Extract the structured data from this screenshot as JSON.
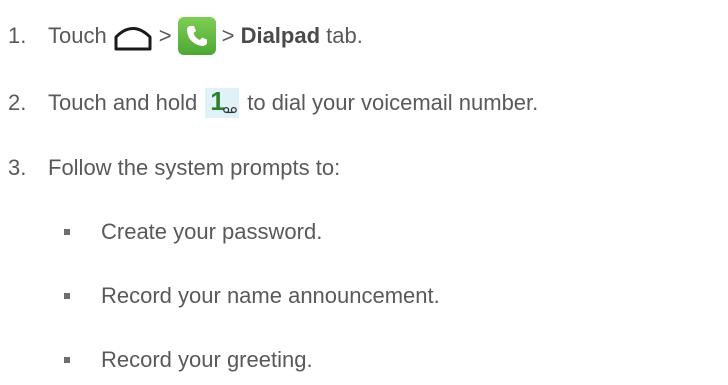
{
  "steps": [
    {
      "number": "1.",
      "touch": "Touch",
      "gt1": ">",
      "gt2": ">",
      "dialpad": "Dialpad",
      "tab": "tab.",
      "home_icon": "home-icon",
      "phone_icon": "phone-app-icon"
    },
    {
      "number": "2.",
      "before": "Touch and hold",
      "key_digit": "1",
      "after": "to dial your voicemail number.",
      "voicemail_icon": "voicemail-icon"
    },
    {
      "number": "3.",
      "text": "Follow the system prompts to:"
    }
  ],
  "bullets": [
    "Create your password.",
    "Record your name announcement.",
    "Record your greeting."
  ],
  "colors": {
    "text": "#595959",
    "phone_green": "#4da734",
    "key_bg": "#dff2f7",
    "key_digit": "#2d7f2d"
  }
}
